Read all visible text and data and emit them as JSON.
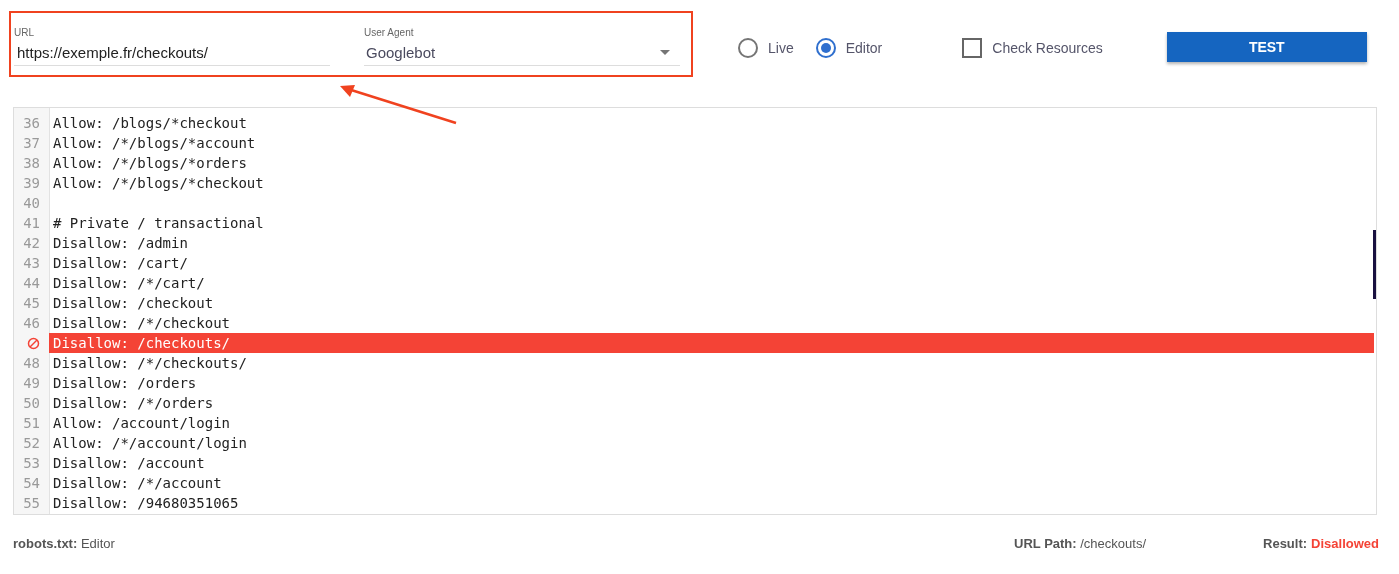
{
  "url_field": {
    "label": "URL",
    "value": "https://exemple.fr/checkouts/"
  },
  "user_agent": {
    "label": "User Agent",
    "value": "Googlebot"
  },
  "modes": [
    {
      "label": "Live",
      "selected": false
    },
    {
      "label": "Editor",
      "selected": true
    }
  ],
  "check_resources": {
    "label": "Check Resources",
    "checked": false
  },
  "test_button": "TEST",
  "editor_lines": [
    {
      "number": "36",
      "text": "Allow: /blogs/*checkout",
      "blocked": false
    },
    {
      "number": "37",
      "text": "Allow: /*/blogs/*account",
      "blocked": false
    },
    {
      "number": "38",
      "text": "Allow: /*/blogs/*orders",
      "blocked": false
    },
    {
      "number": "39",
      "text": "Allow: /*/blogs/*checkout",
      "blocked": false
    },
    {
      "number": "40",
      "blocked": false
    },
    {
      "number": "41",
      "text": "# Private / transactional",
      "blocked": false
    },
    {
      "number": "42",
      "text": "Disallow: /admin",
      "blocked": false
    },
    {
      "number": "43",
      "text": "Disallow: /cart/",
      "blocked": false
    },
    {
      "number": "44",
      "text": "Disallow: /*/cart/",
      "blocked": false
    },
    {
      "number": "45",
      "text": "Disallow: /checkout",
      "blocked": false
    },
    {
      "number": "46",
      "text": "Disallow: /*/checkout",
      "blocked": false
    },
    {
      "text": "Disallow: /checkouts/",
      "blocked": true
    },
    {
      "number": "48",
      "text": "Disallow: /*/checkouts/",
      "blocked": false
    },
    {
      "number": "49",
      "text": "Disallow: /orders",
      "blocked": false
    },
    {
      "number": "50",
      "text": "Disallow: /*/orders",
      "blocked": false
    },
    {
      "number": "51",
      "text": "Allow: /account/login",
      "blocked": false
    },
    {
      "number": "52",
      "text": "Allow: /*/account/login",
      "blocked": false
    },
    {
      "number": "53",
      "text": "Disallow: /account",
      "blocked": false
    },
    {
      "number": "54",
      "text": "Disallow: /*/account",
      "blocked": false
    },
    {
      "number": "55",
      "text": "Disallow: /94680351065",
      "blocked": false
    }
  ],
  "status_bar": {
    "source": "**robots.txt:** Editor",
    "url_path": "**URL Path:** /checkouts/",
    "result": {
      "label": "Result:",
      "value": "Disallowed"
    }
  }
}
